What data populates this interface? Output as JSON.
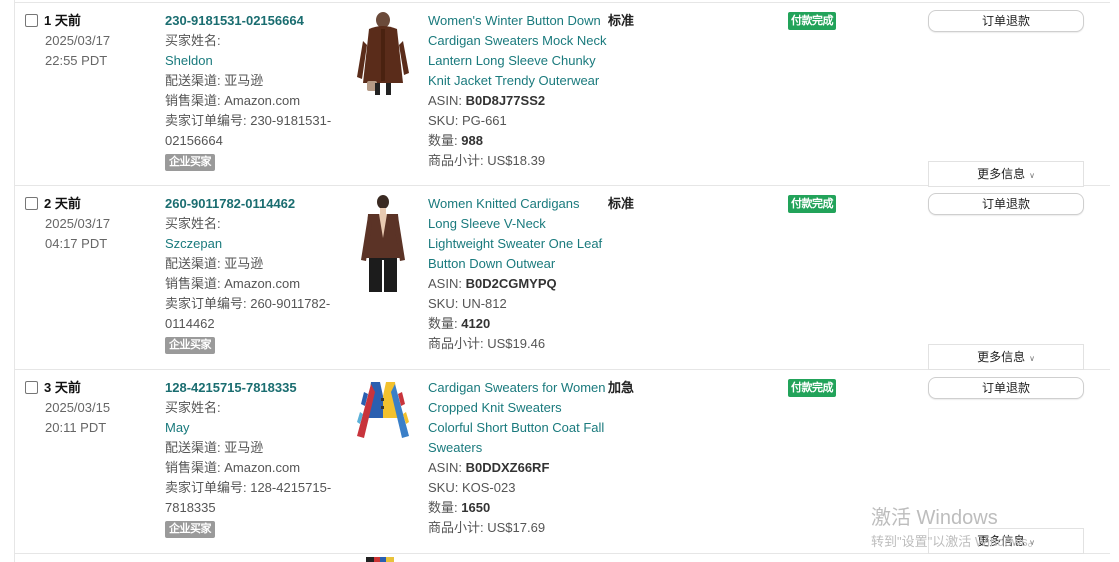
{
  "orders": [
    {
      "days_ago": "1 天前",
      "date": "2025/03/17",
      "time": "22:55 PDT",
      "order_id": "230-9181531-02156664",
      "buyer_label": "买家姓名:",
      "buyer_name": "Sheldon",
      "fulfillment": "配送渠道: 亚马逊",
      "sales_channel": "销售渠道: Amazon.com",
      "seller_order_line1": "卖家订单编号: 230-9181531-",
      "seller_order_line2": "02156664",
      "business_badge": "企业买家",
      "product_title_lines": [
        "Women's Winter Button Down",
        "Cardigan Sweaters Mock Neck",
        "Lantern Long Sleeve Chunky",
        "Knit Jacket Trendy Outerwear"
      ],
      "asin_label": "ASIN:",
      "asin": "B0D8J77SS2",
      "sku": "SKU: PG-661",
      "qty_label": "数量:",
      "qty": "988",
      "subtotal": "商品小计: US$18.39",
      "shipping": "标准",
      "status": "付款完成",
      "refund_label": "订单退款",
      "more_label": "更多信息"
    },
    {
      "days_ago": "2 天前",
      "date": "2025/03/17",
      "time": "04:17 PDT",
      "order_id": "260-9011782-0114462",
      "buyer_label": "买家姓名:",
      "buyer_name": "Szczepan",
      "fulfillment": "配送渠道: 亚马逊",
      "sales_channel": "销售渠道: Amazon.com",
      "seller_order_line1": "卖家订单编号: 260-9011782-",
      "seller_order_line2": "0114462",
      "business_badge": "企业买家",
      "product_title_lines": [
        "Women Knitted Cardigans",
        "Long Sleeve V-Neck",
        "Lightweight Sweater One Leaf",
        "Button Down Outwear"
      ],
      "asin_label": "ASIN:",
      "asin": "B0D2CGMYPQ",
      "sku": "SKU: UN-812",
      "qty_label": "数量:",
      "qty": "4120",
      "subtotal": "商品小计: US$19.46",
      "shipping": "标准",
      "status": "付款完成",
      "refund_label": "订单退款",
      "more_label": "更多信息"
    },
    {
      "days_ago": "3 天前",
      "date": "2025/03/15",
      "time": "20:11 PDT",
      "order_id": "128-4215715-7818335",
      "buyer_label": "买家姓名:",
      "buyer_name": "May",
      "fulfillment": "配送渠道: 亚马逊",
      "sales_channel": "销售渠道: Amazon.com",
      "seller_order_line1": "卖家订单编号: 128-4215715-",
      "seller_order_line2": "7818335",
      "business_badge": "企业买家",
      "product_title_lines": [
        "Cardigan Sweaters for Women",
        "Cropped Knit Sweaters",
        "Colorful Short Button Coat Fall",
        "Sweaters"
      ],
      "asin_label": "ASIN:",
      "asin": "B0DDXZ66RF",
      "sku": "SKU: KOS-023",
      "qty_label": "数量:",
      "qty": "1650",
      "subtotal": "商品小计: US$17.69",
      "shipping": "加急",
      "status": "付款完成",
      "refund_label": "订单退款",
      "more_label": "更多信息"
    }
  ],
  "watermark": {
    "line1": "激活 Windows",
    "line2": "转到\"设置\"以激活 Windows。"
  },
  "colors": {
    "link": "#1a7a7d",
    "status_green": "#22a35a",
    "badge_gray": "#9a9a9a"
  }
}
